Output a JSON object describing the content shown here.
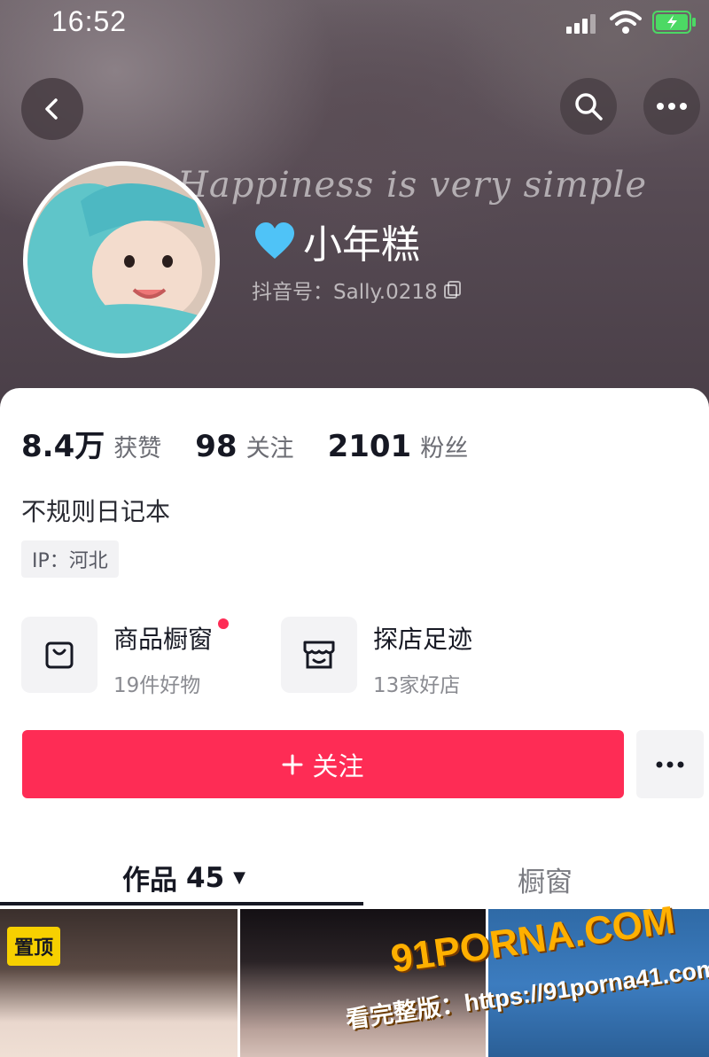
{
  "status_bar": {
    "time": "16:52"
  },
  "cover": {
    "tagline": "Happiness is very simple"
  },
  "profile": {
    "nickname": "小年糕",
    "douyin_id": "抖音号：Sally.0218"
  },
  "stats": [
    {
      "value": "8.4万",
      "label": "获赞"
    },
    {
      "value": "98",
      "label": "关注"
    },
    {
      "value": "2101",
      "label": "粉丝"
    }
  ],
  "bio": "不规则日记本",
  "ip_location": "IP：河北",
  "features": {
    "shop": {
      "title": "商品橱窗",
      "subtitle": "19件好物"
    },
    "visit": {
      "title": "探店足迹",
      "subtitle": "13家好店"
    }
  },
  "follow_button": {
    "label": "关注",
    "icon": "plus-icon"
  },
  "tabs": {
    "works": {
      "label": "作品",
      "count": "45"
    },
    "showcase": {
      "label": "橱窗"
    }
  },
  "grid": {
    "pinned_badge": "置顶"
  },
  "watermark": {
    "brand": "91PORNA.COM",
    "url": "看完整版：https://91porna41.com"
  },
  "colors": {
    "accent": "#fe2c55",
    "pinned": "#f7d000",
    "verified_heart": "#4fc3f7"
  }
}
